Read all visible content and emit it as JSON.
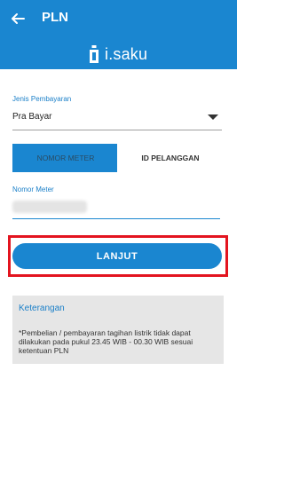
{
  "appbar": {
    "title": "PLN"
  },
  "brand": {
    "name": "i.saku"
  },
  "payment": {
    "label": "Jenis Pembayaran",
    "value": "Pra Bayar"
  },
  "tabs": [
    {
      "label": "NOMOR METER",
      "selected": true
    },
    {
      "label": "ID PELANGGAN",
      "selected": false
    }
  ],
  "meter": {
    "label": "Nomor Meter",
    "value": ""
  },
  "actions": {
    "continue_label": "LANJUT"
  },
  "info": {
    "title": "Keterangan",
    "text": "*Pembelian / pembayaran tagihan listrik tidak dapat dilakukan pada pukul 23.45 WIB - 00.30 WIB sesuai ketentuan PLN"
  },
  "colors": {
    "primary": "#1a86d0",
    "highlight": "#e3141f",
    "info_bg": "#e6e6e6"
  }
}
